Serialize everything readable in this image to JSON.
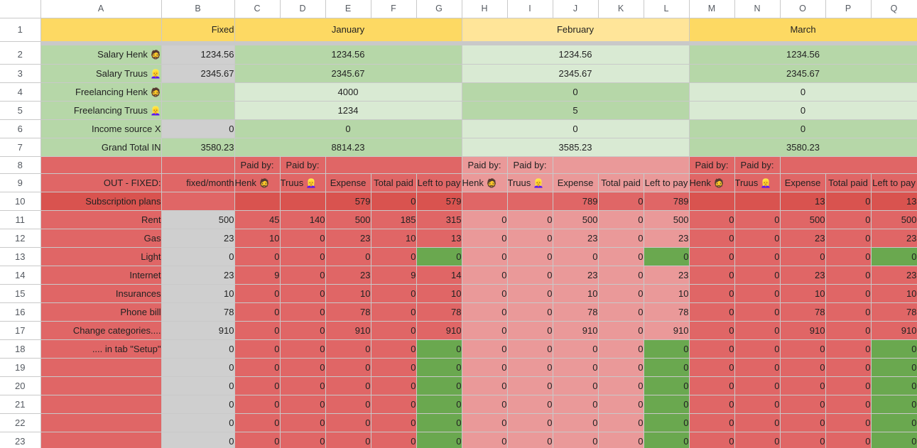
{
  "grid": {
    "column_letters": [
      "A",
      "B",
      "C",
      "D",
      "E",
      "F",
      "G",
      "H",
      "I",
      "J",
      "K",
      "L",
      "M",
      "N",
      "O",
      "P",
      "Q"
    ],
    "row_numbers": [
      "1",
      "2",
      "3",
      "4",
      "5",
      "6",
      "7",
      "8",
      "9",
      "10",
      "11",
      "12",
      "13",
      "14",
      "15",
      "16",
      "17",
      "18",
      "19",
      "20",
      "21",
      "22",
      "23"
    ]
  },
  "colors": {
    "month_january": "#fdd963",
    "month_february": "#ffe599",
    "month_march": "#fdd963",
    "income_dark": "#b6d7a8",
    "income_light": "#d9ead3",
    "paid_highlight": "#6aa84f",
    "out_red": "#e06666",
    "out_red_light": "#ea9999",
    "out_red_dark": "#d9534f",
    "input_grey": "#cfcfcf"
  },
  "headers": {
    "fixed": "Fixed",
    "months": [
      "January",
      "February",
      "March"
    ]
  },
  "income": {
    "rows": [
      {
        "label": "Salary Henk",
        "emoji": "🧔",
        "fixed": "1234.56",
        "jan": "1234.56",
        "feb": "1234.56",
        "mar": "1234.56"
      },
      {
        "label": "Salary Truus",
        "emoji": "👱‍♀️",
        "fixed": "2345.67",
        "jan": "2345.67",
        "feb": "2345.67",
        "mar": "2345.67"
      },
      {
        "label": "Freelancing Henk",
        "emoji": "🧔",
        "fixed": "",
        "jan": "4000",
        "feb": "0",
        "mar": "0"
      },
      {
        "label": "Freelancing Truus",
        "emoji": "👱‍♀️",
        "fixed": "",
        "jan": "1234",
        "feb": "5",
        "mar": "0"
      },
      {
        "label": "Income source X",
        "emoji": "",
        "fixed": "0",
        "jan": "0",
        "feb": "0",
        "mar": "0"
      }
    ],
    "grand_total": {
      "label": "Grand Total IN",
      "fixed": "3580.23",
      "jan": "8814.23",
      "feb": "3585.23",
      "mar": "3580.23"
    }
  },
  "out_header": {
    "title": "OUT - FIXED:",
    "fixed_per_month": "fixed/month",
    "paid_by": "Paid by:",
    "payer_henk": "Henk",
    "payer_henk_emoji": "🧔",
    "payer_truus": "Truus",
    "payer_truus_emoji": "👱‍♀️",
    "expense": "Expense",
    "total_paid": "Total paid",
    "left_to_pay": "Left to pay"
  },
  "out_section_title_row": {
    "label": "Subscription plans",
    "jan": {
      "expense": "579",
      "total_paid": "0",
      "left_to_pay": "579"
    },
    "feb": {
      "expense": "789",
      "total_paid": "0",
      "left_to_pay": "789"
    },
    "mar": {
      "expense": "13",
      "total_paid": "0",
      "left_to_pay": "13"
    }
  },
  "out_rows": [
    {
      "label": "Rent",
      "fixed": "500",
      "jan": {
        "henk": "45",
        "truus": "140",
        "expense": "500",
        "total_paid": "185",
        "left_to_pay": "315",
        "paid_off": false,
        "bold_left": false
      },
      "feb": {
        "henk": "0",
        "truus": "0",
        "expense": "500",
        "total_paid": "0",
        "left_to_pay": "500",
        "paid_off": false,
        "bold_left": false
      },
      "mar": {
        "henk": "0",
        "truus": "0",
        "expense": "500",
        "total_paid": "0",
        "left_to_pay": "500",
        "paid_off": false,
        "bold_left": false
      }
    },
    {
      "label": "Gas",
      "fixed": "23",
      "jan": {
        "henk": "10",
        "truus": "0",
        "expense": "23",
        "total_paid": "10",
        "left_to_pay": "13",
        "paid_off": false,
        "bold_left": true
      },
      "feb": {
        "henk": "0",
        "truus": "0",
        "expense": "23",
        "total_paid": "0",
        "left_to_pay": "23",
        "paid_off": false,
        "bold_left": false
      },
      "mar": {
        "henk": "0",
        "truus": "0",
        "expense": "23",
        "total_paid": "0",
        "left_to_pay": "23",
        "paid_off": false,
        "bold_left": true
      }
    },
    {
      "label": "Light",
      "fixed": "0",
      "jan": {
        "henk": "0",
        "truus": "0",
        "expense": "0",
        "total_paid": "0",
        "left_to_pay": "0",
        "paid_off": true,
        "bold_left": false
      },
      "feb": {
        "henk": "0",
        "truus": "0",
        "expense": "0",
        "total_paid": "0",
        "left_to_pay": "0",
        "paid_off": true,
        "bold_left": false
      },
      "mar": {
        "henk": "0",
        "truus": "0",
        "expense": "0",
        "total_paid": "0",
        "left_to_pay": "0",
        "paid_off": true,
        "bold_left": false
      }
    },
    {
      "label": "Internet",
      "fixed": "23",
      "jan": {
        "henk": "9",
        "truus": "0",
        "expense": "23",
        "total_paid": "9",
        "left_to_pay": "14",
        "paid_off": false,
        "bold_left": false
      },
      "feb": {
        "henk": "0",
        "truus": "0",
        "expense": "23",
        "total_paid": "0",
        "left_to_pay": "23",
        "paid_off": false,
        "bold_left": false
      },
      "mar": {
        "henk": "0",
        "truus": "0",
        "expense": "23",
        "total_paid": "0",
        "left_to_pay": "23",
        "paid_off": false,
        "bold_left": false
      }
    },
    {
      "label": "Insurances",
      "fixed": "10",
      "jan": {
        "henk": "0",
        "truus": "0",
        "expense": "10",
        "total_paid": "0",
        "left_to_pay": "10",
        "paid_off": false,
        "bold_left": false
      },
      "feb": {
        "henk": "0",
        "truus": "0",
        "expense": "10",
        "total_paid": "0",
        "left_to_pay": "10",
        "paid_off": false,
        "bold_left": false
      },
      "mar": {
        "henk": "0",
        "truus": "0",
        "expense": "10",
        "total_paid": "0",
        "left_to_pay": "10",
        "paid_off": false,
        "bold_left": false
      }
    },
    {
      "label": "Phone bill",
      "fixed": "78",
      "jan": {
        "henk": "0",
        "truus": "0",
        "expense": "78",
        "total_paid": "0",
        "left_to_pay": "78",
        "paid_off": false,
        "bold_left": false
      },
      "feb": {
        "henk": "0",
        "truus": "0",
        "expense": "78",
        "total_paid": "0",
        "left_to_pay": "78",
        "paid_off": false,
        "bold_left": false
      },
      "mar": {
        "henk": "0",
        "truus": "0",
        "expense": "78",
        "total_paid": "0",
        "left_to_pay": "78",
        "paid_off": false,
        "bold_left": false
      }
    },
    {
      "label": "Change categories....",
      "fixed": "910",
      "jan": {
        "henk": "0",
        "truus": "0",
        "expense": "910",
        "total_paid": "0",
        "left_to_pay": "910",
        "paid_off": false,
        "bold_left": false
      },
      "feb": {
        "henk": "0",
        "truus": "0",
        "expense": "910",
        "total_paid": "0",
        "left_to_pay": "910",
        "paid_off": false,
        "bold_left": false
      },
      "mar": {
        "henk": "0",
        "truus": "0",
        "expense": "910",
        "total_paid": "0",
        "left_to_pay": "910",
        "paid_off": false,
        "bold_left": false
      }
    },
    {
      "label": ".... in tab \"Setup\"",
      "fixed": "0",
      "jan": {
        "henk": "0",
        "truus": "0",
        "expense": "0",
        "total_paid": "0",
        "left_to_pay": "0",
        "paid_off": true,
        "bold_left": false
      },
      "feb": {
        "henk": "0",
        "truus": "0",
        "expense": "0",
        "total_paid": "0",
        "left_to_pay": "0",
        "paid_off": true,
        "bold_left": false
      },
      "mar": {
        "henk": "0",
        "truus": "0",
        "expense": "0",
        "total_paid": "0",
        "left_to_pay": "0",
        "paid_off": true,
        "bold_left": false
      }
    },
    {
      "label": "",
      "fixed": "0",
      "jan": {
        "henk": "0",
        "truus": "0",
        "expense": "0",
        "total_paid": "0",
        "left_to_pay": "0",
        "paid_off": true,
        "bold_left": false
      },
      "feb": {
        "henk": "0",
        "truus": "0",
        "expense": "0",
        "total_paid": "0",
        "left_to_pay": "0",
        "paid_off": true,
        "bold_left": false
      },
      "mar": {
        "henk": "0",
        "truus": "0",
        "expense": "0",
        "total_paid": "0",
        "left_to_pay": "0",
        "paid_off": true,
        "bold_left": false
      }
    },
    {
      "label": "",
      "fixed": "0",
      "jan": {
        "henk": "0",
        "truus": "0",
        "expense": "0",
        "total_paid": "0",
        "left_to_pay": "0",
        "paid_off": true,
        "bold_left": false
      },
      "feb": {
        "henk": "0",
        "truus": "0",
        "expense": "0",
        "total_paid": "0",
        "left_to_pay": "0",
        "paid_off": true,
        "bold_left": false
      },
      "mar": {
        "henk": "0",
        "truus": "0",
        "expense": "0",
        "total_paid": "0",
        "left_to_pay": "0",
        "paid_off": true,
        "bold_left": false
      }
    },
    {
      "label": "",
      "fixed": "0",
      "jan": {
        "henk": "0",
        "truus": "0",
        "expense": "0",
        "total_paid": "0",
        "left_to_pay": "0",
        "paid_off": true,
        "bold_left": false
      },
      "feb": {
        "henk": "0",
        "truus": "0",
        "expense": "0",
        "total_paid": "0",
        "left_to_pay": "0",
        "paid_off": true,
        "bold_left": false
      },
      "mar": {
        "henk": "0",
        "truus": "0",
        "expense": "0",
        "total_paid": "0",
        "left_to_pay": "0",
        "paid_off": true,
        "bold_left": false
      }
    },
    {
      "label": "",
      "fixed": "0",
      "jan": {
        "henk": "0",
        "truus": "0",
        "expense": "0",
        "total_paid": "0",
        "left_to_pay": "0",
        "paid_off": true,
        "bold_left": false
      },
      "feb": {
        "henk": "0",
        "truus": "0",
        "expense": "0",
        "total_paid": "0",
        "left_to_pay": "0",
        "paid_off": true,
        "bold_left": false
      },
      "mar": {
        "henk": "0",
        "truus": "0",
        "expense": "0",
        "total_paid": "0",
        "left_to_pay": "0",
        "paid_off": true,
        "bold_left": false
      }
    },
    {
      "label": "",
      "fixed": "0",
      "jan": {
        "henk": "0",
        "truus": "0",
        "expense": "0",
        "total_paid": "0",
        "left_to_pay": "0",
        "paid_off": true,
        "bold_left": false
      },
      "feb": {
        "henk": "0",
        "truus": "0",
        "expense": "0",
        "total_paid": "0",
        "left_to_pay": "0",
        "paid_off": true,
        "bold_left": false
      },
      "mar": {
        "henk": "0",
        "truus": "0",
        "expense": "0",
        "total_paid": "0",
        "left_to_pay": "0",
        "paid_off": true,
        "bold_left": false
      }
    }
  ]
}
